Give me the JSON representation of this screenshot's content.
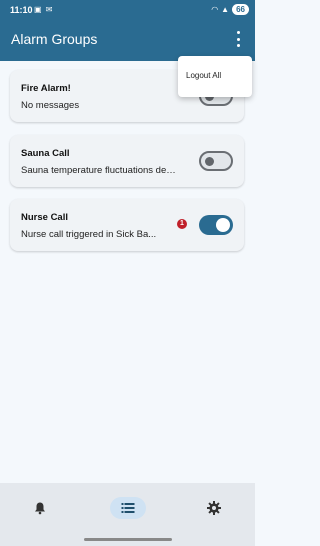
{
  "status_bar": {
    "time": "11:10",
    "battery": "66"
  },
  "header": {
    "title": "Alarm Groups"
  },
  "menu": {
    "items": [
      "Logout All"
    ]
  },
  "groups": [
    {
      "title": "Fire Alarm!",
      "message": "No messages",
      "enabled": false,
      "unread": null
    },
    {
      "title": "Sauna Call",
      "message": "Sauna temperature fluctuations det...",
      "enabled": false,
      "unread": null
    },
    {
      "title": "Nurse Call",
      "message": "Nurse call triggered in Sick Ba...",
      "enabled": true,
      "unread": "1"
    }
  ],
  "bottom_nav": {
    "items": [
      {
        "icon": "bell-icon",
        "active": false
      },
      {
        "icon": "list-icon",
        "active": true
      },
      {
        "icon": "gear-icon",
        "active": false
      }
    ]
  },
  "colors": {
    "primary": "#2a6b91",
    "badge": "#c0202a",
    "background": "#f4f8fc"
  }
}
